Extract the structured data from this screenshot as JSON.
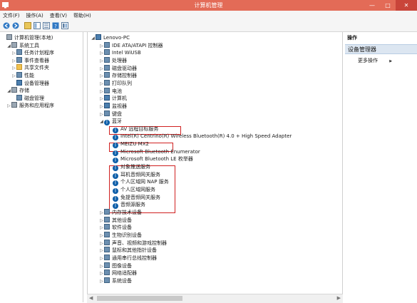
{
  "window": {
    "title": "计算机管理",
    "minimize": "—",
    "maximize": "□",
    "close": "✕"
  },
  "menu": [
    "文件(F)",
    "操作(A)",
    "查看(V)",
    "帮助(H)"
  ],
  "left_tree": [
    {
      "label": "计算机管理(本地)",
      "level": 0,
      "exp": "",
      "icon": "tool"
    },
    {
      "label": "系统工具",
      "level": 1,
      "exp": "◢",
      "icon": "tool"
    },
    {
      "label": "任务计划程序",
      "level": 2,
      "exp": "▷",
      "icon": "dev"
    },
    {
      "label": "事件查看器",
      "level": 2,
      "exp": "▷",
      "icon": "dev"
    },
    {
      "label": "共享文件夹",
      "level": 2,
      "exp": "▷",
      "icon": "folder"
    },
    {
      "label": "性能",
      "level": 2,
      "exp": "▷",
      "icon": "dev"
    },
    {
      "label": "设备管理器",
      "level": 2,
      "exp": "",
      "icon": "pc"
    },
    {
      "label": "存储",
      "level": 1,
      "exp": "◢",
      "icon": "tool"
    },
    {
      "label": "磁盘管理",
      "level": 2,
      "exp": "",
      "icon": "dev"
    },
    {
      "label": "服务和应用程序",
      "level": 1,
      "exp": "▷",
      "icon": "tool"
    }
  ],
  "device_tree": [
    {
      "label": "Lenovo-PC",
      "level": 0,
      "exp": "◢",
      "icon": "pc"
    },
    {
      "label": "IDE ATA/ATAPI 控制器",
      "level": 1,
      "exp": "▷",
      "icon": "dev"
    },
    {
      "label": "Intel WiUSB",
      "level": 1,
      "exp": "▷",
      "icon": "dev"
    },
    {
      "label": "处理器",
      "level": 1,
      "exp": "▷",
      "icon": "dev"
    },
    {
      "label": "磁盘驱动器",
      "level": 1,
      "exp": "▷",
      "icon": "dev"
    },
    {
      "label": "存储控制器",
      "level": 1,
      "exp": "▷",
      "icon": "dev"
    },
    {
      "label": "打印队列",
      "level": 1,
      "exp": "▷",
      "icon": "dev"
    },
    {
      "label": "电池",
      "level": 1,
      "exp": "▷",
      "icon": "dev"
    },
    {
      "label": "计算机",
      "level": 1,
      "exp": "▷",
      "icon": "pc"
    },
    {
      "label": "监视器",
      "level": 1,
      "exp": "▷",
      "icon": "pc"
    },
    {
      "label": "键盘",
      "level": 1,
      "exp": "▷",
      "icon": "dev"
    },
    {
      "label": "蓝牙",
      "level": 1,
      "exp": "◢",
      "icon": "bt"
    },
    {
      "label": "AV 远程目标服务",
      "level": 2,
      "exp": "",
      "icon": "bt"
    },
    {
      "label": "Intel(R) Centrino(R) Wireless Bluetooth(R) 4.0 + High Speed Adapter",
      "level": 2,
      "exp": "",
      "icon": "bt"
    },
    {
      "label": "MEIZU MX2",
      "level": 2,
      "exp": "",
      "icon": "bt"
    },
    {
      "label": "Microsoft Bluetooth Enumerator",
      "level": 2,
      "exp": "",
      "icon": "bt"
    },
    {
      "label": "Microsoft Bluetooth LE 枚举器",
      "level": 2,
      "exp": "",
      "icon": "bt"
    },
    {
      "label": "对象推送服务",
      "level": 2,
      "exp": "",
      "icon": "bt"
    },
    {
      "label": "耳机音频网关服务",
      "level": 2,
      "exp": "",
      "icon": "bt"
    },
    {
      "label": "个人区域网 NAP 服务",
      "level": 2,
      "exp": "",
      "icon": "bt"
    },
    {
      "label": "个人区域网服务",
      "level": 2,
      "exp": "",
      "icon": "bt"
    },
    {
      "label": "免提音频网关服务",
      "level": 2,
      "exp": "",
      "icon": "bt"
    },
    {
      "label": "音频源服务",
      "level": 2,
      "exp": "",
      "icon": "bt"
    },
    {
      "label": "内存技术设备",
      "level": 1,
      "exp": "▷",
      "icon": "dev"
    },
    {
      "label": "其他设备",
      "level": 1,
      "exp": "▷",
      "icon": "dev"
    },
    {
      "label": "软件设备",
      "level": 1,
      "exp": "▷",
      "icon": "dev"
    },
    {
      "label": "生物识别设备",
      "level": 1,
      "exp": "▷",
      "icon": "dev"
    },
    {
      "label": "声音、视频和游戏控制器",
      "level": 1,
      "exp": "▷",
      "icon": "dev"
    },
    {
      "label": "鼠标和其他指针设备",
      "level": 1,
      "exp": "▷",
      "icon": "dev"
    },
    {
      "label": "通用串行总线控制器",
      "level": 1,
      "exp": "▷",
      "icon": "dev"
    },
    {
      "label": "图像设备",
      "level": 1,
      "exp": "▷",
      "icon": "dev"
    },
    {
      "label": "网络适配器",
      "level": 1,
      "exp": "▷",
      "icon": "dev"
    },
    {
      "label": "系统设备",
      "level": 1,
      "exp": "▷",
      "icon": "dev"
    }
  ],
  "actions": {
    "header": "操作",
    "selected": "设备管理器",
    "more": "更多操作",
    "more_arrow": "▶"
  },
  "colors": {
    "titlebar": "#e36b57",
    "highlight_box": "#d02020"
  }
}
